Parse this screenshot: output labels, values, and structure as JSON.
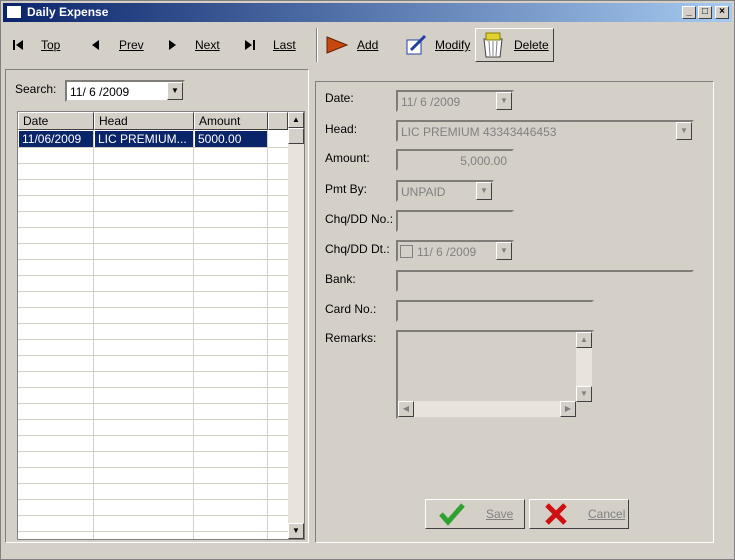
{
  "window": {
    "title": "Daily Expense"
  },
  "toolbar": {
    "top": "Top",
    "prev": "Prev",
    "next": "Next",
    "last": "Last",
    "add": "Add",
    "modify": "Modify",
    "delete": "Delete"
  },
  "search": {
    "label": "Search:",
    "value": "11/ 6 /2009"
  },
  "grid": {
    "headers": [
      "Date",
      "Head",
      "Amount"
    ],
    "rows": [
      {
        "date": "11/06/2009",
        "head": "LIC PREMIUM...",
        "amount": "5000.00"
      }
    ]
  },
  "form": {
    "date_label": "Date:",
    "date_value": "11/ 6 /2009",
    "head_label": "Head:",
    "head_value": "LIC PREMIUM 43343446453",
    "amount_label": "Amount:",
    "amount_value": "5,000.00",
    "pmtby_label": "Pmt By:",
    "pmtby_value": "UNPAID",
    "chqno_label": "Chq/DD No.:",
    "chqno_value": "",
    "chqdt_label": "Chq/DD Dt.:",
    "chqdt_value": "11/ 6 /2009",
    "bank_label": "Bank:",
    "bank_value": "",
    "card_label": "Card No.:",
    "card_value": "",
    "remarks_label": "Remarks:",
    "remarks_value": ""
  },
  "actions": {
    "save": "Save",
    "cancel": "Cancel"
  }
}
